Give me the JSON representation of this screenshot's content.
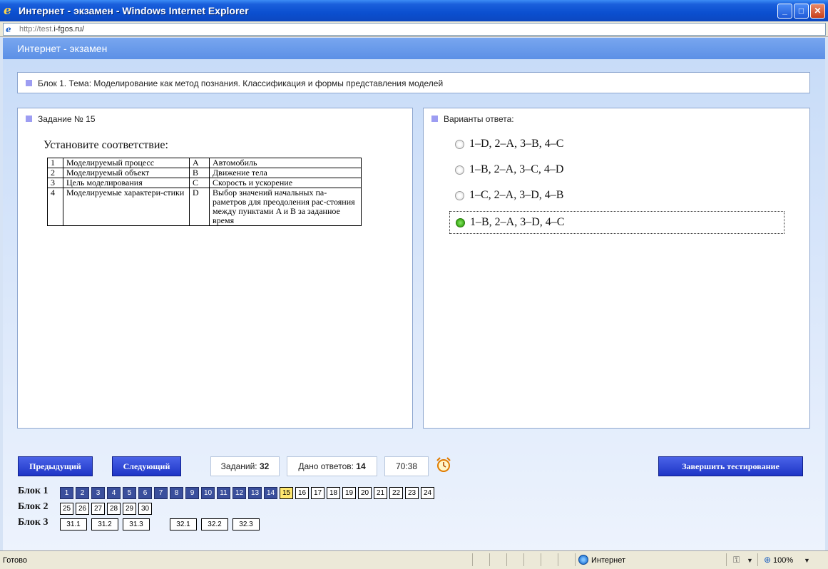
{
  "window": {
    "title": "Интернет - экзамен - Windows Internet Explorer",
    "address_prefix": "http://test.",
    "address_host": "i-fgos.ru/"
  },
  "app": {
    "title": "Интернет - экзамен"
  },
  "block": {
    "title": "Блок 1. Тема: Моделирование как метод познания. Классификация и формы представления моделей"
  },
  "task": {
    "label": "Задание № 15",
    "heading": "Установите соответствие:",
    "rows": [
      {
        "n": "1",
        "left": "Моделируемый процесс",
        "key": "A",
        "right": "Автомобиль"
      },
      {
        "n": "2",
        "left": "Моделируемый объект",
        "key": "B",
        "right": "Движение тела"
      },
      {
        "n": "3",
        "left": "Цель моделирования",
        "key": "C",
        "right": "Скорость и ускорение"
      },
      {
        "n": "4",
        "left": "Моделируемые характери-стики",
        "key": "D",
        "right": "Выбор значений начальных па-раметров для преодоления рас-стояния между пунктами A и B за  заданное время"
      }
    ]
  },
  "answers": {
    "label": "Варианты ответа:",
    "options": [
      {
        "text": "1–D, 2–A, 3–B, 4–C",
        "selected": false
      },
      {
        "text": "1–B, 2–A, 3–C, 4–D",
        "selected": false
      },
      {
        "text": "1–C, 2–A, 3–D, 4–B",
        "selected": false
      },
      {
        "text": "1–B, 2–A, 3–D, 4–C",
        "selected": true
      }
    ]
  },
  "toolbar": {
    "prev_label": "Предыдущий",
    "next_label": "Следующий",
    "tasks_label": "Заданий:",
    "tasks_count": "32",
    "answered_label": "Дано ответов:",
    "answered_count": "14",
    "timer": "70:38",
    "finish_label": "Завершить тестирование"
  },
  "navigator": {
    "blocks": [
      {
        "label": "Блок 1",
        "items": [
          {
            "n": "1",
            "state": "done"
          },
          {
            "n": "2",
            "state": "done"
          },
          {
            "n": "3",
            "state": "done"
          },
          {
            "n": "4",
            "state": "done"
          },
          {
            "n": "5",
            "state": "done"
          },
          {
            "n": "6",
            "state": "done"
          },
          {
            "n": "7",
            "state": "done"
          },
          {
            "n": "8",
            "state": "done"
          },
          {
            "n": "9",
            "state": "done"
          },
          {
            "n": "10",
            "state": "done"
          },
          {
            "n": "11",
            "state": "done"
          },
          {
            "n": "12",
            "state": "done"
          },
          {
            "n": "13",
            "state": "done"
          },
          {
            "n": "14",
            "state": "done"
          },
          {
            "n": "15",
            "state": "current"
          },
          {
            "n": "16",
            "state": "open"
          },
          {
            "n": "17",
            "state": "open"
          },
          {
            "n": "18",
            "state": "open"
          },
          {
            "n": "19",
            "state": "open"
          },
          {
            "n": "20",
            "state": "open"
          },
          {
            "n": "21",
            "state": "open"
          },
          {
            "n": "22",
            "state": "open"
          },
          {
            "n": "23",
            "state": "open"
          },
          {
            "n": "24",
            "state": "open"
          }
        ]
      },
      {
        "label": "Блок 2",
        "items": [
          {
            "n": "25",
            "state": "open"
          },
          {
            "n": "26",
            "state": "open"
          },
          {
            "n": "27",
            "state": "open"
          },
          {
            "n": "28",
            "state": "open"
          },
          {
            "n": "29",
            "state": "open"
          },
          {
            "n": "30",
            "state": "open"
          }
        ]
      },
      {
        "label": "Блок 3",
        "items": [
          {
            "n": "31.1",
            "state": "open"
          },
          {
            "n": "31.2",
            "state": "open"
          },
          {
            "n": "31.3",
            "state": "open"
          },
          {
            "n": "32.1",
            "state": "open"
          },
          {
            "n": "32.2",
            "state": "open"
          },
          {
            "n": "32.3",
            "state": "open"
          }
        ]
      }
    ]
  },
  "statusbar": {
    "status": "Готово",
    "zone": "Интернет",
    "zoom": "100%"
  },
  "icons": {
    "browser": "ie-logo-icon",
    "timer": "alarm-clock-icon",
    "zone": "globe-icon",
    "zoom": "zoom-icon",
    "protected_mode": "lock-icon"
  },
  "colors": {
    "header": "#5c90e6",
    "button": "#1e35c6",
    "done_cell": "#3a4f9c",
    "current_cell": "#ffe870",
    "bullet": "#9d9df2",
    "selected_radio": "#2ea10a"
  }
}
